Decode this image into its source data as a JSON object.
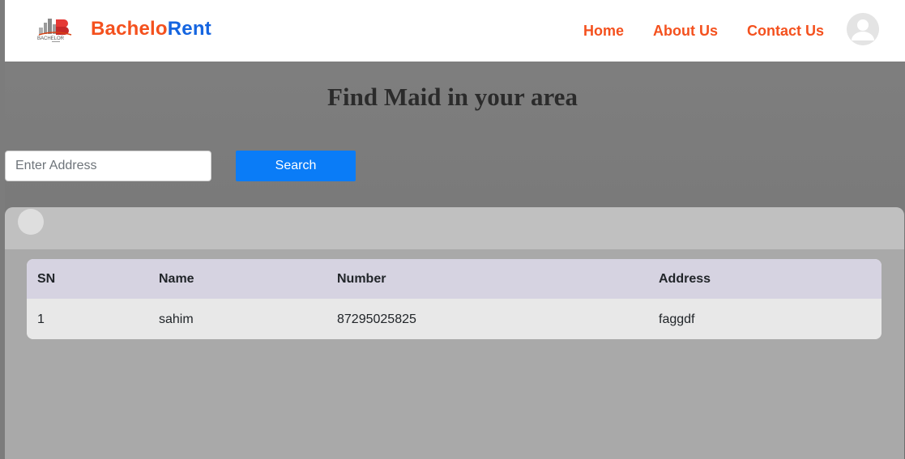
{
  "navbar": {
    "brand_part1": "Bachelo",
    "brand_part2": "Rent",
    "logo_text": "BACHELOR",
    "links": [
      {
        "label": "Home"
      },
      {
        "label": "About Us"
      },
      {
        "label": "Contact Us"
      }
    ]
  },
  "main": {
    "title": "Find Maid in your area"
  },
  "search": {
    "placeholder": "Enter Address",
    "value": "",
    "button_label": "Search"
  },
  "table": {
    "headers": [
      "SN",
      "Name",
      "Number",
      "Address"
    ],
    "rows": [
      [
        "1",
        "sahim",
        "87295025825",
        "faggdf"
      ]
    ]
  },
  "colors": {
    "brand_orange": "#f4511e",
    "brand_blue": "#1565e0",
    "search_button": "#0a7cf7",
    "table_header": "#d6d3e1"
  },
  "icons": {
    "logo": "building-logo-icon",
    "avatar": "user-avatar-icon",
    "panel_dot": "circle-icon"
  }
}
